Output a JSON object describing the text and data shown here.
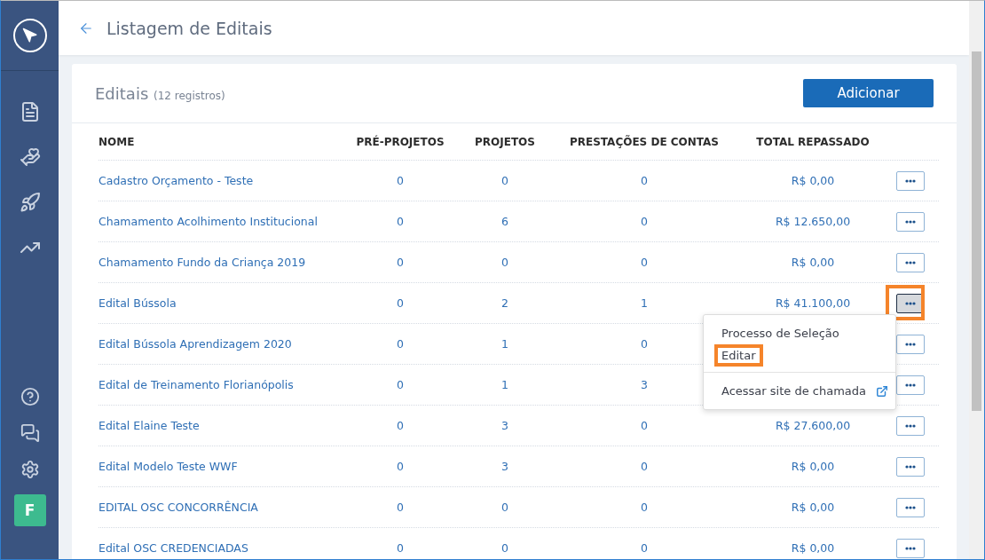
{
  "header": {
    "title": "Listagem de Editais"
  },
  "sidebar": {
    "avatar": "F"
  },
  "card": {
    "title": "Editais",
    "count": "(12 registros)",
    "add_button": "Adicionar"
  },
  "table": {
    "columns": [
      "NOME",
      "PRÉ-PROJETOS",
      "PROJETOS",
      "PRESTAÇÕES DE CONTAS",
      "TOTAL REPASSADO"
    ],
    "rows": [
      {
        "name": "Cadastro Orçamento - Teste",
        "pre_projetos": "0",
        "projetos": "0",
        "prestacoes": "0",
        "total": "R$ 0,00",
        "menu_open": false
      },
      {
        "name": "Chamamento Acolhimento Institucional",
        "pre_projetos": "0",
        "projetos": "6",
        "prestacoes": "0",
        "total": "R$ 12.650,00",
        "menu_open": false
      },
      {
        "name": "Chamamento Fundo da Criança 2019",
        "pre_projetos": "0",
        "projetos": "0",
        "prestacoes": "0",
        "total": "R$ 0,00",
        "menu_open": false
      },
      {
        "name": "Edital Bússola",
        "pre_projetos": "0",
        "projetos": "2",
        "prestacoes": "1",
        "total": "R$ 41.100,00",
        "menu_open": true
      },
      {
        "name": "Edital Bússola Aprendizagem 2020",
        "pre_projetos": "0",
        "projetos": "1",
        "prestacoes": "0",
        "menu_open": false
      },
      {
        "name": "Edital de Treinamento Florianópolis",
        "pre_projetos": "0",
        "projetos": "1",
        "prestacoes": "3",
        "menu_open": false
      },
      {
        "name": "Edital Elaine Teste",
        "pre_projetos": "0",
        "projetos": "3",
        "prestacoes": "0",
        "total": "R$ 27.600,00",
        "menu_open": false
      },
      {
        "name": "Edital Modelo Teste WWF",
        "pre_projetos": "0",
        "projetos": "3",
        "prestacoes": "0",
        "total": "R$ 0,00",
        "menu_open": false
      },
      {
        "name": "EDITAL OSC CONCORRÊNCIA",
        "pre_projetos": "0",
        "projetos": "0",
        "prestacoes": "0",
        "total": "R$ 0,00",
        "menu_open": false
      },
      {
        "name": "Edital OSC CREDENCIADAS",
        "pre_projetos": "0",
        "projetos": "0",
        "prestacoes": "0",
        "total": "R$ 0,00",
        "menu_open": false
      }
    ]
  },
  "menu": {
    "items": [
      {
        "label": "Processo de Seleção",
        "kind": "plain",
        "highlighted": false
      },
      {
        "label": "Editar",
        "kind": "plain",
        "highlighted": true
      },
      {
        "label": "Acessar site de chamada",
        "kind": "external",
        "highlighted": false
      }
    ]
  }
}
